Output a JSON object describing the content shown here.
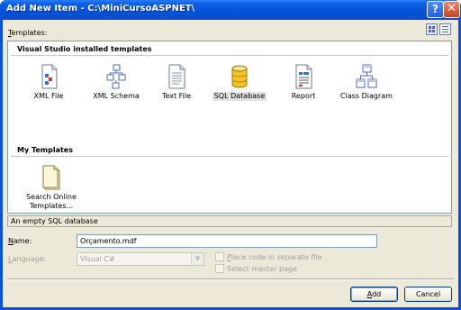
{
  "window": {
    "title": "Add New Item - C:\\MiniCursoASPNET\\"
  },
  "title_buttons": {
    "help": "?",
    "close": "✕"
  },
  "templates_label": {
    "underline": "T",
    "rest": "emplates:"
  },
  "view_buttons": {
    "large_icons": "large-icons-view-icon",
    "small_icons": "small-icons-view-icon"
  },
  "sections": {
    "installed": {
      "header": "Visual Studio installed templates",
      "items": [
        {
          "label": "XML File",
          "icon": "xml-file-icon"
        },
        {
          "label": "XML Schema",
          "icon": "xml-schema-icon"
        },
        {
          "label": "Text File",
          "icon": "text-file-icon"
        },
        {
          "label": "SQL Database",
          "icon": "sql-database-icon",
          "selected": true
        },
        {
          "label": "Report",
          "icon": "report-icon"
        },
        {
          "label": "Class Diagram",
          "icon": "class-diagram-icon"
        }
      ]
    },
    "mine": {
      "header": "My Templates",
      "items": [
        {
          "label_line1": "Search Online",
          "label_line2": "Templates...",
          "icon": "search-online-templates-icon"
        }
      ]
    }
  },
  "status": "An empty SQL database",
  "name": {
    "label_underline": "N",
    "label_rest": "ame:",
    "value": "Orçamento.mdf"
  },
  "language": {
    "label_underline": "L",
    "label_rest": "anguage:",
    "value": "Visual C#"
  },
  "options": {
    "separate_file": {
      "underline": "P",
      "rest": "lace code in separate file"
    },
    "master_page": {
      "underline": "",
      "rest": "Select master page"
    }
  },
  "buttons": {
    "add_underline": "A",
    "add_rest": "dd",
    "cancel": "Cancel"
  },
  "colors": {
    "titlebar": "#0553d8",
    "dialog_bg": "#ece9d8",
    "selection": "#e2e2e2"
  }
}
